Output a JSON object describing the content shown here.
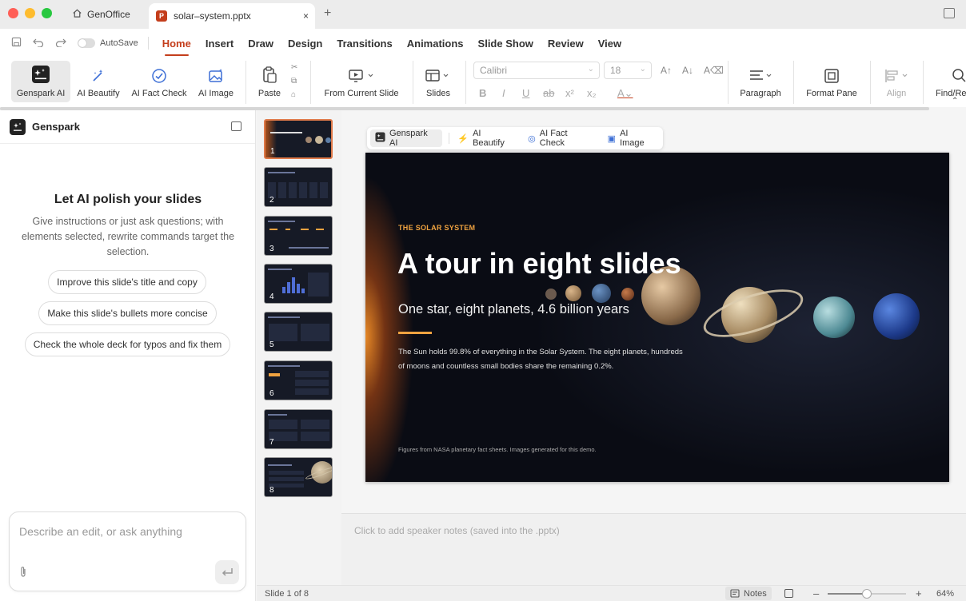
{
  "window": {
    "home_tab": "GenOffice",
    "doc_tab": "solar–system.pptx",
    "doc_tab_badge": "P",
    "close_glyph": "×",
    "new_tab_glyph": "+"
  },
  "menubar": {
    "autosave_label": "AutoSave",
    "items": [
      "Home",
      "Insert",
      "Draw",
      "Design",
      "Transitions",
      "Animations",
      "Slide Show",
      "Review",
      "View"
    ],
    "active": "Home"
  },
  "ribbon": {
    "genspark_ai": "Genspark AI",
    "ai_beautify": "AI Beautify",
    "ai_fact_check": "AI Fact Check",
    "ai_image": "AI Image",
    "paste": "Paste",
    "from_current_slide": "From Current Slide",
    "slides": "Slides",
    "font_name": "Calibri",
    "font_size": "18",
    "paragraph": "Paragraph",
    "format_pane": "Format Pane",
    "align": "Align",
    "find_replace": "Find/Re"
  },
  "left_panel": {
    "title": "Genspark",
    "heading": "Let AI polish your slides",
    "subtitle": "Give instructions or just ask questions; with elements selected, rewrite commands target the selection.",
    "suggestions": [
      "Improve this slide's title and copy",
      "Make this slide's bullets more concise",
      "Check the whole deck for typos and fix them"
    ],
    "input_placeholder": "Describe an edit, or ask anything"
  },
  "thumbnails": {
    "numbers": [
      "1",
      "2",
      "3",
      "4",
      "5",
      "6",
      "7",
      "8"
    ],
    "active": 1
  },
  "floating_toolbar": {
    "genspark_ai": "Genspark AI",
    "ai_beautify": "AI Beautify",
    "ai_fact_check": "AI Fact Check",
    "ai_image": "AI Image"
  },
  "slide": {
    "kicker": "THE SOLAR SYSTEM",
    "title": "A tour in eight slides",
    "subtitle": "One star, eight planets, 4.6 billion years",
    "body": "The Sun holds 99.8% of everything in the Solar System. The eight planets, hundreds of moons and countless small bodies share the remaining 0.2%.",
    "footer": "Figures from NASA planetary fact sheets. Images generated for this demo.",
    "accent_color": "#f0a340"
  },
  "notes": {
    "placeholder": "Click to add speaker notes (saved into the .pptx)"
  },
  "statusbar": {
    "slide_position": "Slide 1 of 8",
    "notes_label": "Notes",
    "zoom": "64%",
    "zoom_level": 0.64,
    "minus": "–",
    "plus": "+"
  },
  "colors": {
    "brand": "#c43e1c",
    "ai_blue": "#3d6fd6"
  }
}
